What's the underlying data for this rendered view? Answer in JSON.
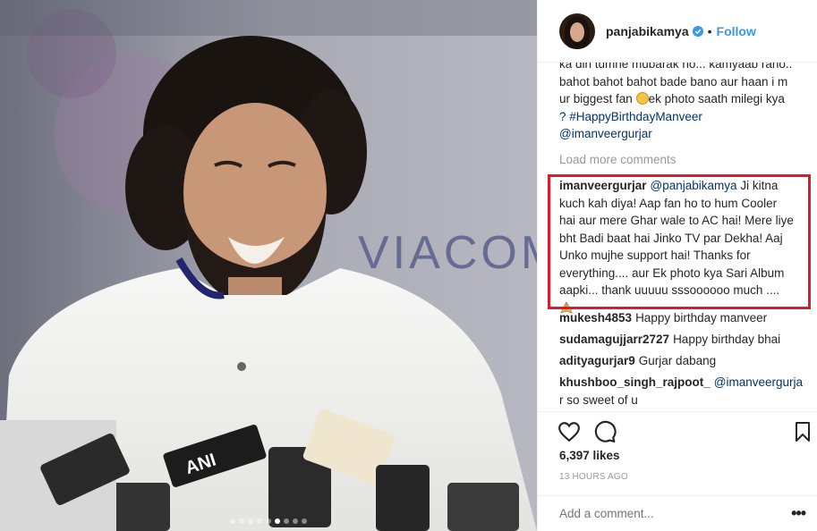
{
  "photo": {
    "backdrop_text": "VIACOM",
    "mic_label": "ANI",
    "carousel": {
      "count": 9,
      "active": 6
    }
  },
  "header": {
    "username": "panjabikamya",
    "separator": "•",
    "follow_label": "Follow"
  },
  "caption": {
    "line1": "ka din tumhe mubarak ho... kamyaab raho..",
    "line2": "bahot bahot bahot bade bano aur haan i m",
    "line3_a": "ur biggest fan ",
    "line3_b": "ek photo saath milegi kya",
    "line4": "? #HappyBirthdayManveer",
    "line5": "@imanveergurjar"
  },
  "load_more": "Load more comments",
  "comments": [
    {
      "user": "imanveergurjar",
      "mention": "@panjabikamya",
      "lines": [
        " Ji kitna",
        "kuch kah diya! Aap fan ho to hum Cooler",
        "hai aur mere Ghar wale to AC hai! Mere liye",
        "bht Badi baat hai Jinko TV par Dekha! Aaj",
        "Unko mujhe support hai! Thanks for",
        "everything.... aur Ek photo kya Sari Album",
        "aapki... thank uuuuu sssoooooo much ...."
      ]
    },
    {
      "user": "mukesh4853",
      "text": "Happy birthday manveer"
    },
    {
      "user": "sudamagujjarr2727",
      "text": "Happy birthday bhai"
    },
    {
      "user": "adityagurjar9",
      "text": "Gurjar dabang"
    },
    {
      "user": "khushboo_singh_rajpoot_",
      "mention": "@imanveergurja",
      "line2": "r so sweet of u"
    }
  ],
  "likes": "6,397 likes",
  "time_ago": "13 HOURS AGO",
  "add_comment_placeholder": "Add a comment...",
  "more_label": "•••",
  "colors": {
    "link": "#003569",
    "follow": "#3897f0",
    "highlight": "#e0182b"
  },
  "icons": [
    "heart-icon",
    "comment-icon",
    "bookmark-icon",
    "verified-icon"
  ]
}
